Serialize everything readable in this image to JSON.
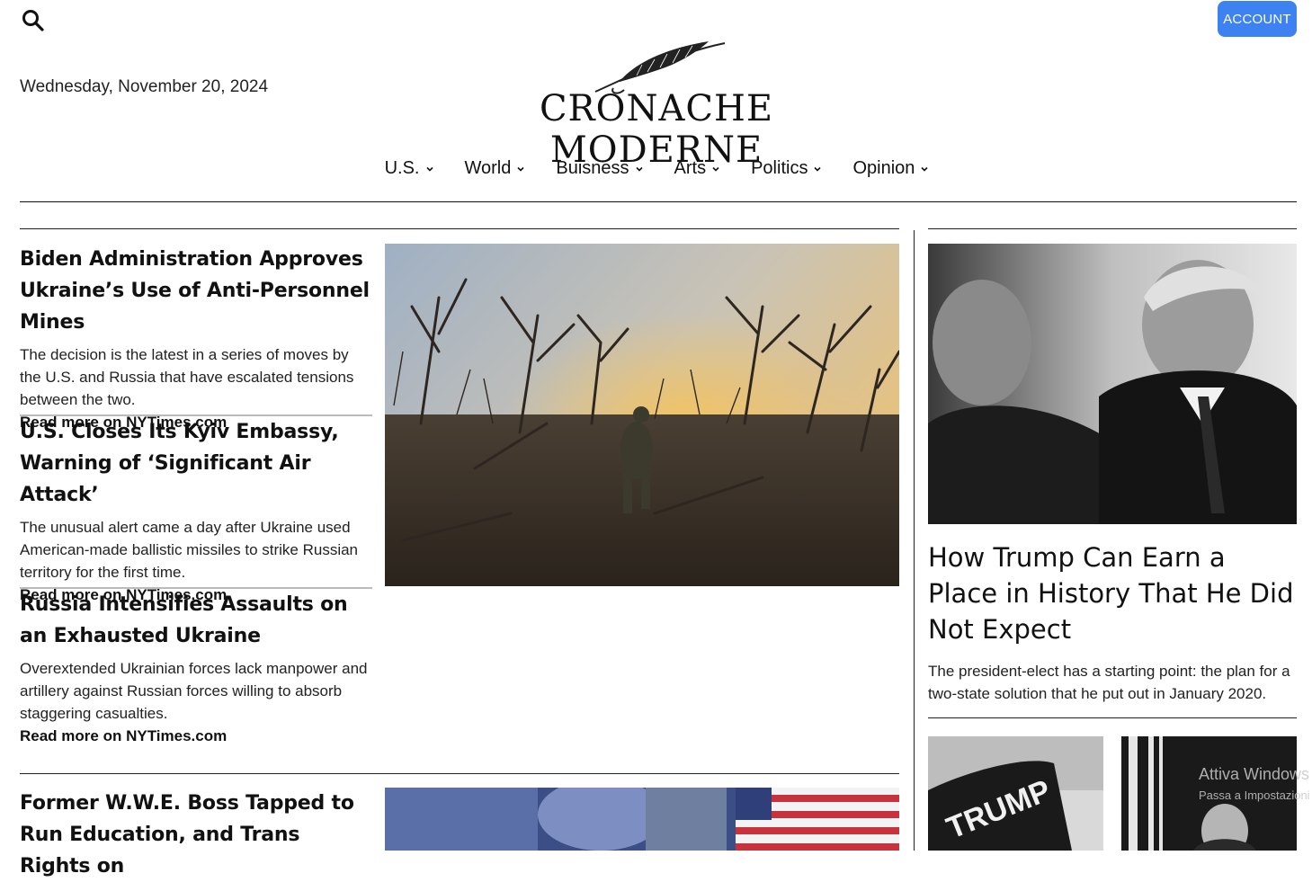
{
  "header": {
    "account_label": "ACCOUNT",
    "date": "Wednesday, November 20, 2024",
    "logo_text": "CRONACHE MODERNE"
  },
  "nav": {
    "items": [
      {
        "label": "U.S."
      },
      {
        "label": "World"
      },
      {
        "label": "Buisness"
      },
      {
        "label": "Arts"
      },
      {
        "label": "Politics"
      },
      {
        "label": "Opinion"
      }
    ]
  },
  "left_articles": [
    {
      "headline": "Biden Administration Approves Ukraine’s Use of Anti-Personnel Mines",
      "summary": "The decision is the latest in a series of moves by the U.S. and Russia that have escalated tensions between the two.",
      "read_more": "Read more on NYTimes.com"
    },
    {
      "headline": "U.S. Closes Its Kyiv Embassy, Warning of ‘Significant Air Attack’",
      "summary": "The unusual alert came a day after Ukraine used American-made ballistic missiles to strike Russian territory for the first time.",
      "read_more": "Read more on NYTimes.com"
    },
    {
      "headline": "Russia Intensifies Assaults on an Exhausted Ukraine",
      "summary": "Overextended Ukrainian forces lack manpower and artillery against Russian forces willing to absorb staggering casualties.",
      "read_more": "Read more on NYTimes.com"
    },
    {
      "headline": "Former W.W.E. Boss Tapped to Run Education, and Trans Rights on"
    }
  ],
  "right_feature": {
    "headline": "How Trump Can Earn a Place in History That He Did Not Expect",
    "summary": "The president-elect has a starting point: the plan for a two-state solution that he put out in January 2020."
  },
  "images": {
    "trump_flag_text": "TRUMP"
  },
  "watermark": {
    "line1": "Attiva Windows",
    "line2": "Passa a Impostazioni"
  },
  "colors": {
    "accent": "#3d82f0",
    "text": "#111111",
    "rule": "#222222",
    "separator": "#bbbbbb"
  }
}
